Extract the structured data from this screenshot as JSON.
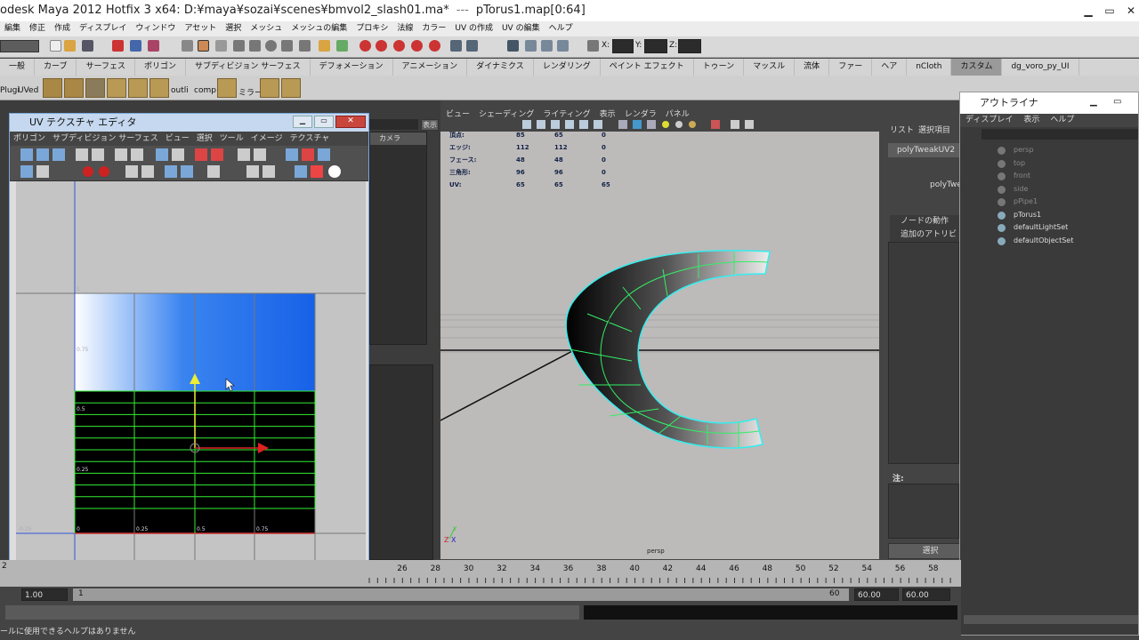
{
  "window": {
    "title": "odesk Maya 2012 Hotfix 3 x64: D:¥maya¥sozai¥scenes¥bmvol2_slash01.ma*",
    "sep": "---",
    "file": "pTorus1.map[0:64]"
  },
  "menubar": [
    "編集",
    "修正",
    "作成",
    "ディスプレイ",
    "ウィンドウ",
    "アセット",
    "選択",
    "メッシュ",
    "メッシュの編集",
    "プロキシ",
    "法線",
    "カラー",
    "UV の作成",
    "UV の編集",
    "ヘルプ"
  ],
  "toolbar": {
    "x_label": "X:",
    "y_label": "Y:",
    "z_label": "Z:"
  },
  "shelf_tabs": [
    "一般",
    "カーブ",
    "サーフェス",
    "ポリゴン",
    "サブディビジョン サーフェス",
    "デフォメーション",
    "アニメーション",
    "ダイナミクス",
    "レンダリング",
    "ペイント エフェクト",
    "トゥーン",
    "マッスル",
    "流体",
    "ファー",
    "ヘア",
    "nCloth",
    "カスタム",
    "dg_voro_py_UI"
  ],
  "shelf_labels": {
    "plugi": "Plugi",
    "uved": "UVed",
    "outli": "outli",
    "comp": "comp",
    "mira": "ミラー"
  },
  "uv_editor": {
    "title": "UV テクスチャ エディタ",
    "menu": [
      "ポリゴン",
      "サブディビジョン サーフェス",
      "ビュー",
      "選択",
      "ツール",
      "イメージ",
      "テクスチャ"
    ],
    "axis_labels": {
      "x0": "0",
      "x025": "0.25",
      "x05": "0.5",
      "x075": "0.75",
      "xneg": "-0.25",
      "y025": "0.25",
      "y05": "0.5",
      "y075": "0.75",
      "y1": "1"
    }
  },
  "panel_left": {
    "camera_label": "カメラ",
    "display_btn": "表示"
  },
  "viewport": {
    "menu": [
      "ビュー",
      "シェーディング",
      "ライティング",
      "表示",
      "レンダラ",
      "パネル"
    ],
    "hud": [
      {
        "label": "頂点:",
        "a": "85",
        "b": "65",
        "c": "0"
      },
      {
        "label": "エッジ:",
        "a": "112",
        "b": "112",
        "c": "0"
      },
      {
        "label": "フェース:",
        "a": "48",
        "b": "48",
        "c": "0"
      },
      {
        "label": "三角形:",
        "a": "96",
        "b": "96",
        "c": "0"
      },
      {
        "label": "UV:",
        "a": "65",
        "b": "65",
        "c": "65"
      }
    ],
    "camera_name": "persp",
    "coord": "-5"
  },
  "attr_editor": {
    "tabs": [
      "リスト",
      "選択項目"
    ],
    "node_tab": "polyTweakUV2",
    "node_name": "polyTwe",
    "sections": [
      "ノードの動作",
      "追加のアトリビ"
    ],
    "note": "注: polyTweakUV",
    "select_btn": "選択"
  },
  "outliner": {
    "title": "アウトライナ",
    "menu": [
      "ディスプレイ",
      "表示",
      "ヘルプ"
    ],
    "items": [
      {
        "name": "persp",
        "dim": true
      },
      {
        "name": "top",
        "dim": true
      },
      {
        "name": "front",
        "dim": true
      },
      {
        "name": "side",
        "dim": true
      },
      {
        "name": "pPipe1",
        "dim": true
      },
      {
        "name": "pTorus1",
        "dim": false
      },
      {
        "name": "defaultLightSet",
        "dim": false
      },
      {
        "name": "defaultObjectSet",
        "dim": false
      }
    ]
  },
  "timeline": {
    "ticks": [
      "26",
      "28",
      "30",
      "32",
      "34",
      "36",
      "38",
      "40",
      "42",
      "44",
      "46",
      "48",
      "50",
      "52",
      "54",
      "56",
      "58",
      "60"
    ],
    "left_num": "2"
  },
  "range": {
    "start": "1.00",
    "start2": "1",
    "end_small": "60",
    "end": "60.00",
    "end2": "60.00"
  },
  "help_text": "ールに使用できるヘルプはありません"
}
